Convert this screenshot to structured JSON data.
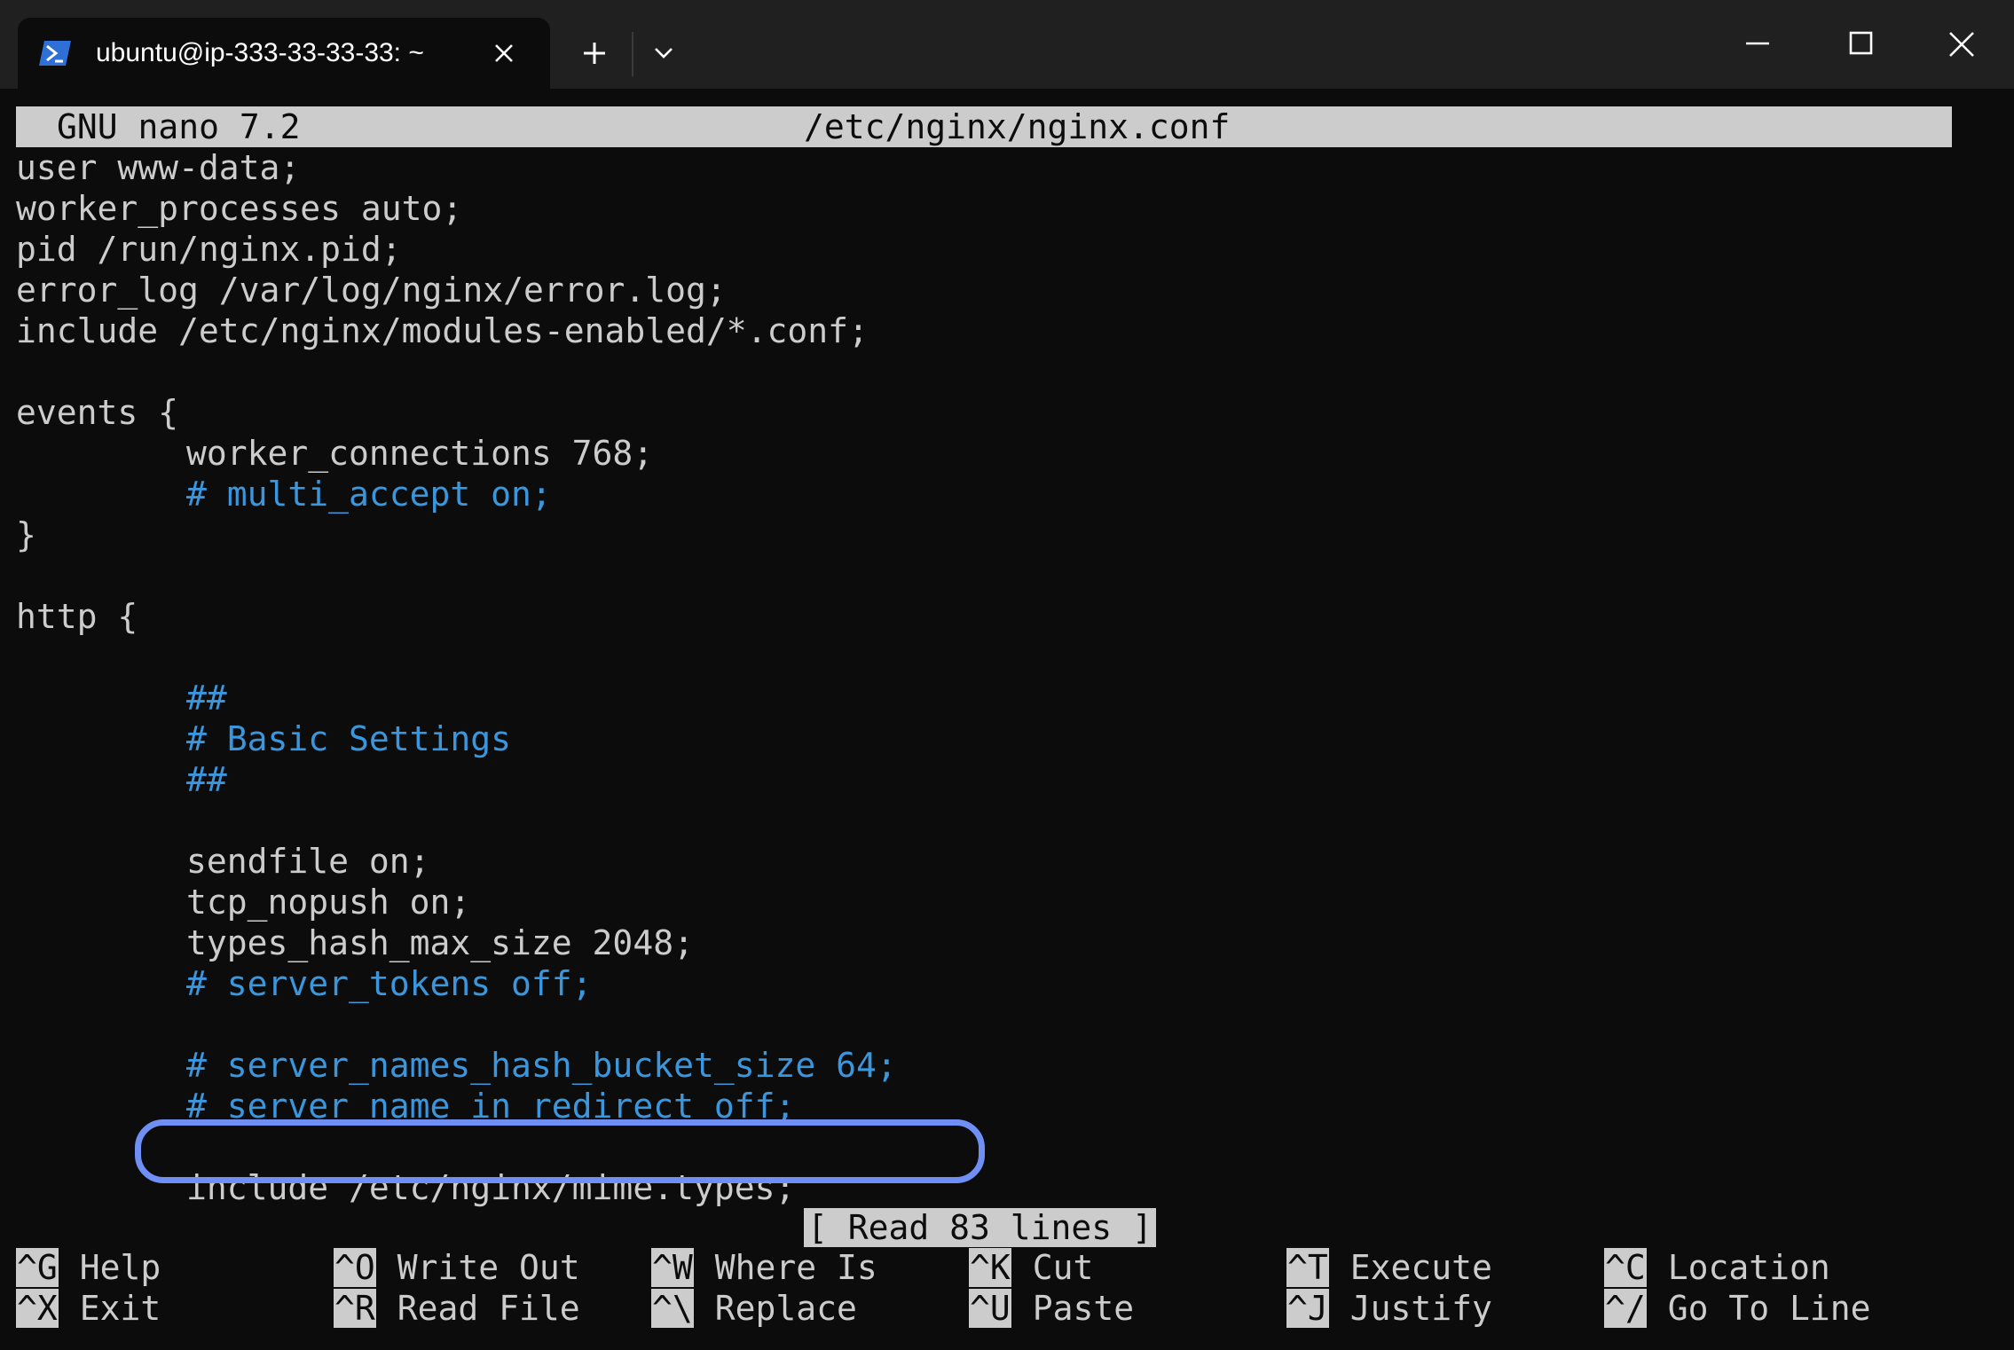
{
  "window": {
    "tab_title": "ubuntu@ip-333-33-33-33: ~",
    "tab_icon": "powershell-terminal-icon"
  },
  "nano": {
    "version": "GNU nano 7.2",
    "filename": "/etc/nginx/nginx.conf",
    "lines": [
      {
        "text": "user www-data;",
        "indent": false,
        "comment": false
      },
      {
        "text": "worker_processes auto;",
        "indent": false,
        "comment": false
      },
      {
        "text": "pid /run/nginx.pid;",
        "indent": false,
        "comment": false
      },
      {
        "text": "error_log /var/log/nginx/error.log;",
        "indent": false,
        "comment": false
      },
      {
        "text": "include /etc/nginx/modules-enabled/*.conf;",
        "indent": false,
        "comment": false
      },
      {
        "text": "",
        "indent": false,
        "comment": false
      },
      {
        "text": "events {",
        "indent": false,
        "comment": false
      },
      {
        "text": "worker_connections 768;",
        "indent": true,
        "comment": false
      },
      {
        "text": "# multi_accept on;",
        "indent": true,
        "comment": true
      },
      {
        "text": "}",
        "indent": false,
        "comment": false
      },
      {
        "text": "",
        "indent": false,
        "comment": false
      },
      {
        "text": "http {",
        "indent": false,
        "comment": false
      },
      {
        "text": "",
        "indent": false,
        "comment": false
      },
      {
        "text": "##",
        "indent": true,
        "comment": true
      },
      {
        "text": "# Basic Settings",
        "indent": true,
        "comment": true
      },
      {
        "text": "##",
        "indent": true,
        "comment": true
      },
      {
        "text": "",
        "indent": false,
        "comment": false
      },
      {
        "text": "sendfile on;",
        "indent": true,
        "comment": false
      },
      {
        "text": "tcp_nopush on;",
        "indent": true,
        "comment": false
      },
      {
        "text": "types_hash_max_size 2048;",
        "indent": true,
        "comment": false
      },
      {
        "text": "# server_tokens off;",
        "indent": true,
        "comment": true
      },
      {
        "text": "",
        "indent": false,
        "comment": false
      },
      {
        "text": "# server_names_hash_bucket_size 64;",
        "indent": true,
        "comment": true
      },
      {
        "text": "# server_name_in_redirect off;",
        "indent": true,
        "comment": true
      },
      {
        "text": "",
        "indent": false,
        "comment": false
      },
      {
        "text": "include /etc/nginx/mime.types;",
        "indent": true,
        "comment": false
      }
    ],
    "status": "[ Read 83 lines ]",
    "shortcuts": [
      {
        "key": "^G",
        "label": "Help"
      },
      {
        "key": "^X",
        "label": "Exit"
      },
      {
        "key": "^O",
        "label": "Write Out"
      },
      {
        "key": "^R",
        "label": "Read File"
      },
      {
        "key": "^W",
        "label": "Where Is"
      },
      {
        "key": "^\\",
        "label": "Replace"
      },
      {
        "key": "^K",
        "label": "Cut"
      },
      {
        "key": "^U",
        "label": "Paste"
      },
      {
        "key": "^T",
        "label": "Execute"
      },
      {
        "key": "^J",
        "label": "Justify"
      },
      {
        "key": "^C",
        "label": "Location"
      },
      {
        "key": "^/",
        "label": "Go To Line"
      }
    ]
  },
  "colors": {
    "terminal_bg": "#0c0c0c",
    "text": "#cccccc",
    "comment": "#3a96dd",
    "highlight_box": "#6f8ff5",
    "titlebar": "#202020"
  }
}
